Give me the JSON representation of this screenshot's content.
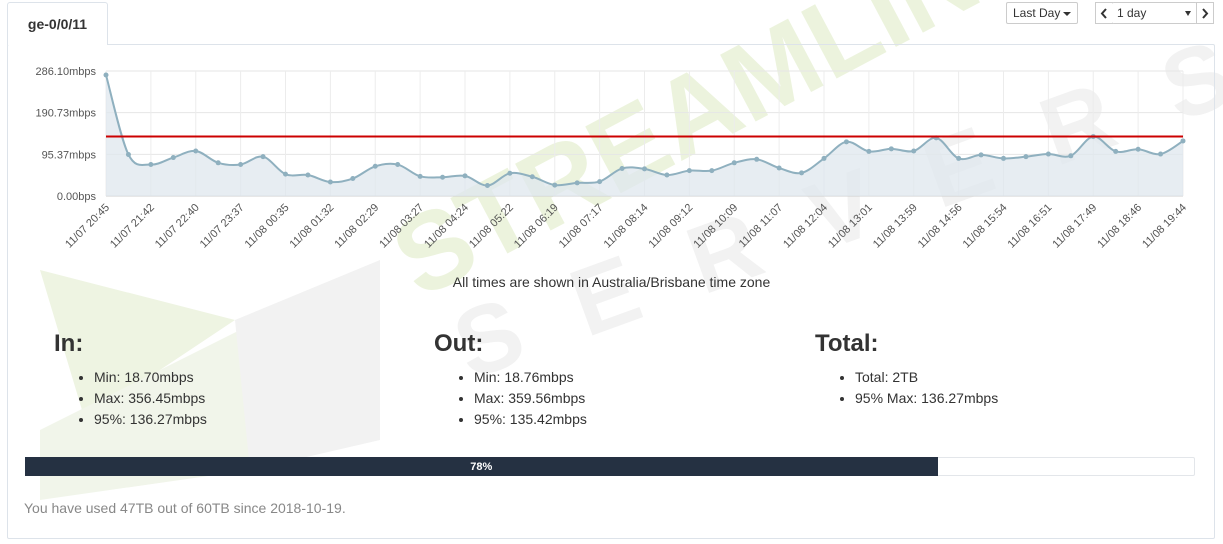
{
  "tab": {
    "label": "ge-0/0/11"
  },
  "controls": {
    "range_label": "Last Day",
    "period_label": "1 day"
  },
  "chart_data": {
    "type": "area",
    "y_ticks": [
      "286.10mbps",
      "190.73mbps",
      "95.37mbps",
      "0.00bps"
    ],
    "y_tick_values": [
      286.1,
      190.73,
      95.37,
      0
    ],
    "ylim": [
      0,
      286.1
    ],
    "x_labels": [
      "11/07 20:45",
      "11/07 21:42",
      "11/07 22:40",
      "11/07 23:37",
      "11/08 00:35",
      "11/08 01:32",
      "11/08 02:29",
      "11/08 03:27",
      "11/08 04:24",
      "11/08 05:22",
      "11/08 06:19",
      "11/08 07:17",
      "11/08 08:14",
      "11/08 09:12",
      "11/08 10:09",
      "11/08 11:07",
      "11/08 12:04",
      "11/08 13:01",
      "11/08 13:59",
      "11/08 14:56",
      "11/08 15:54",
      "11/08 16:51",
      "11/08 17:49",
      "11/08 18:46",
      "11/08 19:44"
    ],
    "series": [
      {
        "values": [
          277,
          95,
          72,
          88,
          103,
          76,
          72,
          90,
          50,
          48,
          32,
          40,
          68,
          72,
          45,
          43,
          46,
          24,
          52,
          44,
          25,
          30,
          33,
          63,
          62,
          48,
          58,
          58,
          76,
          84,
          64,
          53,
          86,
          124,
          102,
          108,
          103,
          133,
          86,
          94,
          86,
          90,
          96,
          92,
          136,
          102,
          107,
          96,
          126
        ],
        "color": "#8fb0bf"
      }
    ],
    "threshold": {
      "value": 136.27,
      "color": "#cc0000"
    },
    "grid": true,
    "timezone_note": "All times are shown in Australia/Brisbane time zone"
  },
  "stats": {
    "in": {
      "title": "In:",
      "items": [
        "Min: 18.70mbps",
        "Max: 356.45mbps",
        "95%: 136.27mbps"
      ]
    },
    "out": {
      "title": "Out:",
      "items": [
        "Min: 18.76mbps",
        "Max: 359.56mbps",
        "95%: 135.42mbps"
      ]
    },
    "total": {
      "title": "Total:",
      "items": [
        "Total: 2TB",
        "95% Max: 136.27mbps"
      ]
    }
  },
  "usage": {
    "percent": 78,
    "percent_label": "78%",
    "note": "You have used 47TB out of 60TB since 2018-10-19."
  },
  "watermark": {
    "line1": "STREAMLINE",
    "line2": "SERVERS"
  }
}
